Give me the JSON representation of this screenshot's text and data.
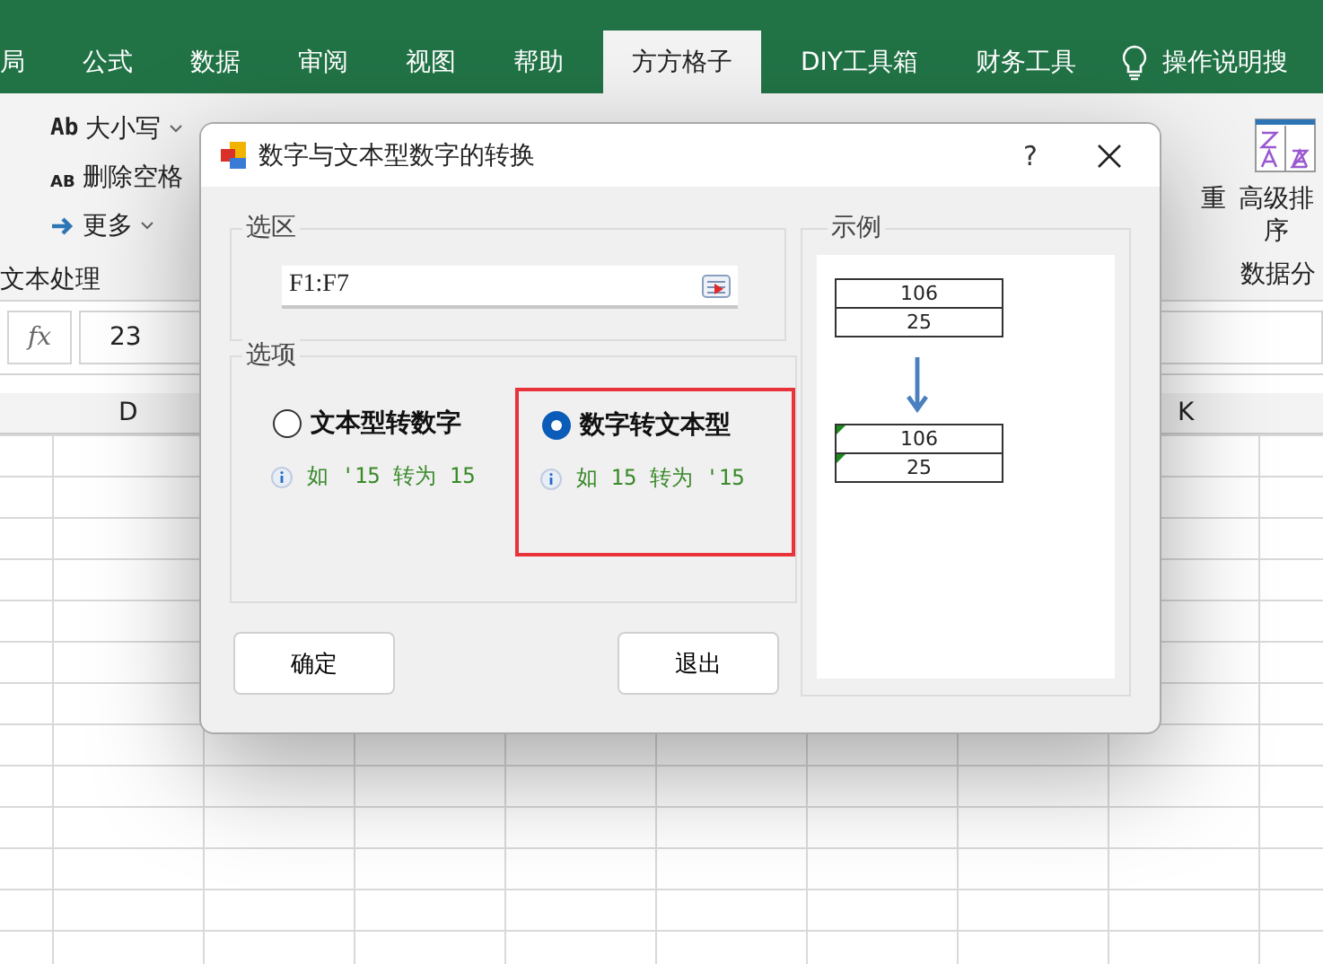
{
  "ribbon_tabs": [
    {
      "label": "局",
      "selected": false
    },
    {
      "label": "公式",
      "selected": false
    },
    {
      "label": "数据",
      "selected": false
    },
    {
      "label": "审阅",
      "selected": false
    },
    {
      "label": "视图",
      "selected": false
    },
    {
      "label": "帮助",
      "selected": false
    },
    {
      "label": "方方格子",
      "selected": true
    },
    {
      "label": "DIY工具箱",
      "selected": false
    },
    {
      "label": "财务工具",
      "selected": false
    }
  ],
  "tell_me": "操作说明搜",
  "ribbon_left": {
    "items": [
      {
        "kind": "case",
        "icon_text": "Ab",
        "label": "大小写"
      },
      {
        "kind": "trim",
        "icon_text": "AB",
        "label": "删除空格"
      },
      {
        "kind": "more",
        "label": "更多"
      }
    ],
    "group_label": "文本处理"
  },
  "ribbon_right": {
    "items": [
      {
        "label": "重"
      },
      {
        "label": "高级排序"
      }
    ],
    "group_label": "数据分"
  },
  "formula_bar": {
    "fx": "fx",
    "value": "23"
  },
  "columns": [
    "D",
    "K"
  ],
  "dialog": {
    "title": "数字与文本型数字的转换",
    "help": "?",
    "range_group": {
      "label": "选区",
      "value": "F1:F7"
    },
    "options_group": {
      "label": "选项",
      "options": [
        {
          "label": "文本型转数字",
          "hint": "如 '15 转为 15",
          "selected": false,
          "highlighted": false
        },
        {
          "label": "数字转文本型",
          "hint": "如 15 转为 '15",
          "selected": true,
          "highlighted": true
        }
      ]
    },
    "buttons": [
      "确定",
      "退出"
    ],
    "example": {
      "label": "示例",
      "before": [
        "106",
        "25"
      ],
      "after": [
        "106",
        "25"
      ]
    }
  }
}
